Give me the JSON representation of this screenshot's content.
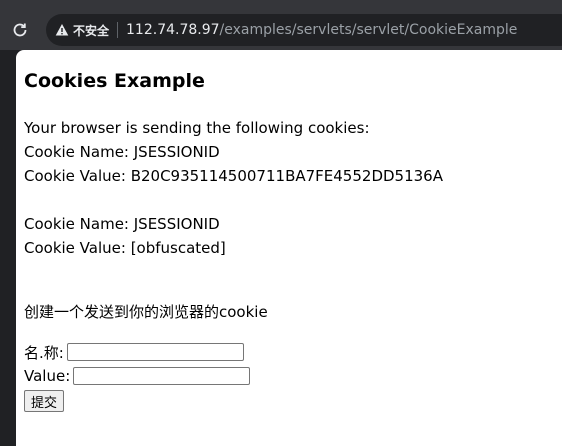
{
  "browser": {
    "security_label": "不安全",
    "url_host": "112.74.78.97",
    "url_path": "/examples/servlets/servlet/CookieExample"
  },
  "page": {
    "title": "Cookies Example",
    "intro": "Your browser is sending the following cookies:",
    "cookies": [
      {
        "name_line": "Cookie Name: JSESSIONID",
        "value_line": "Cookie Value: B20C935114500711BA7FE4552DD5136A"
      },
      {
        "name_line": "Cookie Name: JSESSIONID",
        "value_line": "Cookie Value: [obfuscated]"
      }
    ],
    "create_text": "创建一个发送到你的浏览器的cookie",
    "form": {
      "name_label": "名.称:",
      "name_value": "",
      "value_label": "Value:",
      "value_value": "",
      "submit_label": "提交"
    }
  }
}
